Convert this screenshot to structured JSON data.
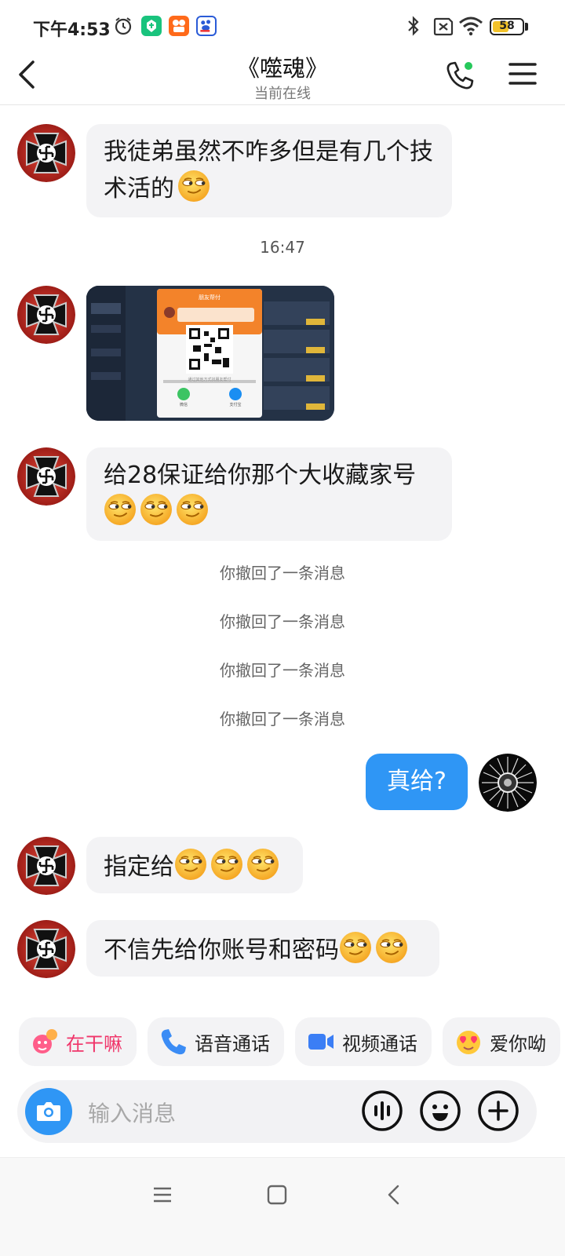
{
  "status_bar": {
    "time": "下午4:53",
    "battery_level": "58",
    "battery_percent": 58,
    "icons": [
      "alarm-icon",
      "app-notification-icon",
      "app-notification-icon",
      "app-notification-icon",
      "bluetooth-icon",
      "sim-off-icon",
      "wifi-icon",
      "battery-icon"
    ]
  },
  "header": {
    "title": "《噬魂》",
    "subtitle": "当前在线"
  },
  "messages": {
    "m1": {
      "text": "我徒弟虽然不咋多但是有几个技术活的",
      "emoji": "smirk-emoji"
    },
    "time1": "16:47",
    "m2": {
      "image": "shared-screenshot",
      "card_title": "朋友帮付",
      "card_footer": "通过其他方式找朋友帮付",
      "option1": "微信",
      "option2": "支付宝"
    },
    "m3": {
      "text": "给28保证给你那个大收藏家号",
      "emoji_count": 3
    },
    "recalled": [
      "你撤回了一条消息",
      "你撤回了一条消息",
      "你撤回了一条消息",
      "你撤回了一条消息"
    ],
    "m4": {
      "text": "真给?",
      "sender": "me"
    },
    "m5": {
      "text": "指定给",
      "emoji_count": 3
    },
    "m6": {
      "text": "不信先给你账号和密码",
      "emoji_count": 2
    }
  },
  "quick_actions": [
    {
      "label": "在干嘛",
      "color": "#f0356a"
    },
    {
      "label": "语音通话",
      "color": "#222222"
    },
    {
      "label": "视频通话",
      "color": "#222222"
    },
    {
      "label": "爱你呦",
      "color": "#222222"
    }
  ],
  "input": {
    "placeholder": "输入消息"
  },
  "colors": {
    "accent": "#2f96f5",
    "bubble_other": "#f3f3f5"
  }
}
